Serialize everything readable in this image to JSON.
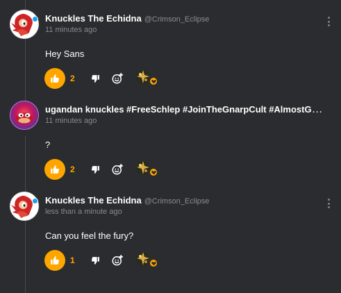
{
  "comments": [
    {
      "author": "Knuckles The Echidna",
      "handle": "@Crimson_Eclipse",
      "timestamp": "11 minutes ago",
      "body": "Hey Sans",
      "likes": "2"
    },
    {
      "author": "ugandan knuckles #FreeSchlep #JoinTheGnarpCult #AlmostGJFa...",
      "handle": "",
      "timestamp": "11 minutes ago",
      "body": "?",
      "likes": "2"
    },
    {
      "author": "Knuckles The Echidna",
      "handle": "@Crimson_Eclipse",
      "timestamp": "less than a minute ago",
      "body": "Can you feel the fury?",
      "likes": "1"
    }
  ],
  "icons": {
    "like": "thumbs-up-icon",
    "dislike": "thumbs-down-icon",
    "add_reaction": "add-reaction-icon",
    "reaction": "sparkle-reaction-icon",
    "reaction_badge": "heart-icon",
    "menu": "more-vertical-icon",
    "avatar_badge": "blue-dot-icon"
  },
  "colors": {
    "background": "#2b2c2f",
    "accent": "#ffa500",
    "muted_text": "#898a8e",
    "thread_line": "#4a4b50"
  }
}
